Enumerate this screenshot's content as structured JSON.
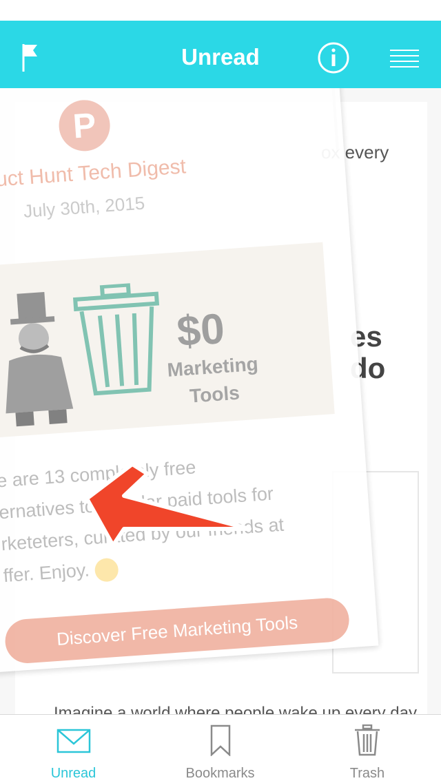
{
  "nav": {
    "title": "Unread",
    "left_icon": "flag-icon",
    "right_icons": [
      "info-icon",
      "menu-icon"
    ],
    "accent_color": "#2bd8e6"
  },
  "background_article": {
    "text_top_fragment": "ox every",
    "heading_fragment_1": "es",
    "heading_fragment_2": "do",
    "body_fragment": "Imagine a world where people wake up every day"
  },
  "dragged_card": {
    "logo_letter": "P",
    "title": "oduct Hunt Tech Digest",
    "date": "July 30th, 2015",
    "banner_price": "$0",
    "banner_caption_1": "Marketing",
    "banner_caption_2": "Tools",
    "body_lines": [
      "e are 13 completely free",
      "ernatives to popular paid tools for",
      "rketeters, curated by our friends at",
      "ffer. Enjoy."
    ],
    "cta_label": "Discover Free Marketing Tools"
  },
  "tabs": [
    {
      "label": "Unread",
      "icon": "envelope-icon",
      "active": true
    },
    {
      "label": "Bookmarks",
      "icon": "bookmark-icon",
      "active": false
    },
    {
      "label": "Trash",
      "icon": "trash-icon",
      "active": false
    }
  ],
  "colors": {
    "accent": "#2bd8e6",
    "tab_active": "#2bc6d8",
    "arrow": "#f0452a",
    "cta": "#f1b4a3"
  }
}
